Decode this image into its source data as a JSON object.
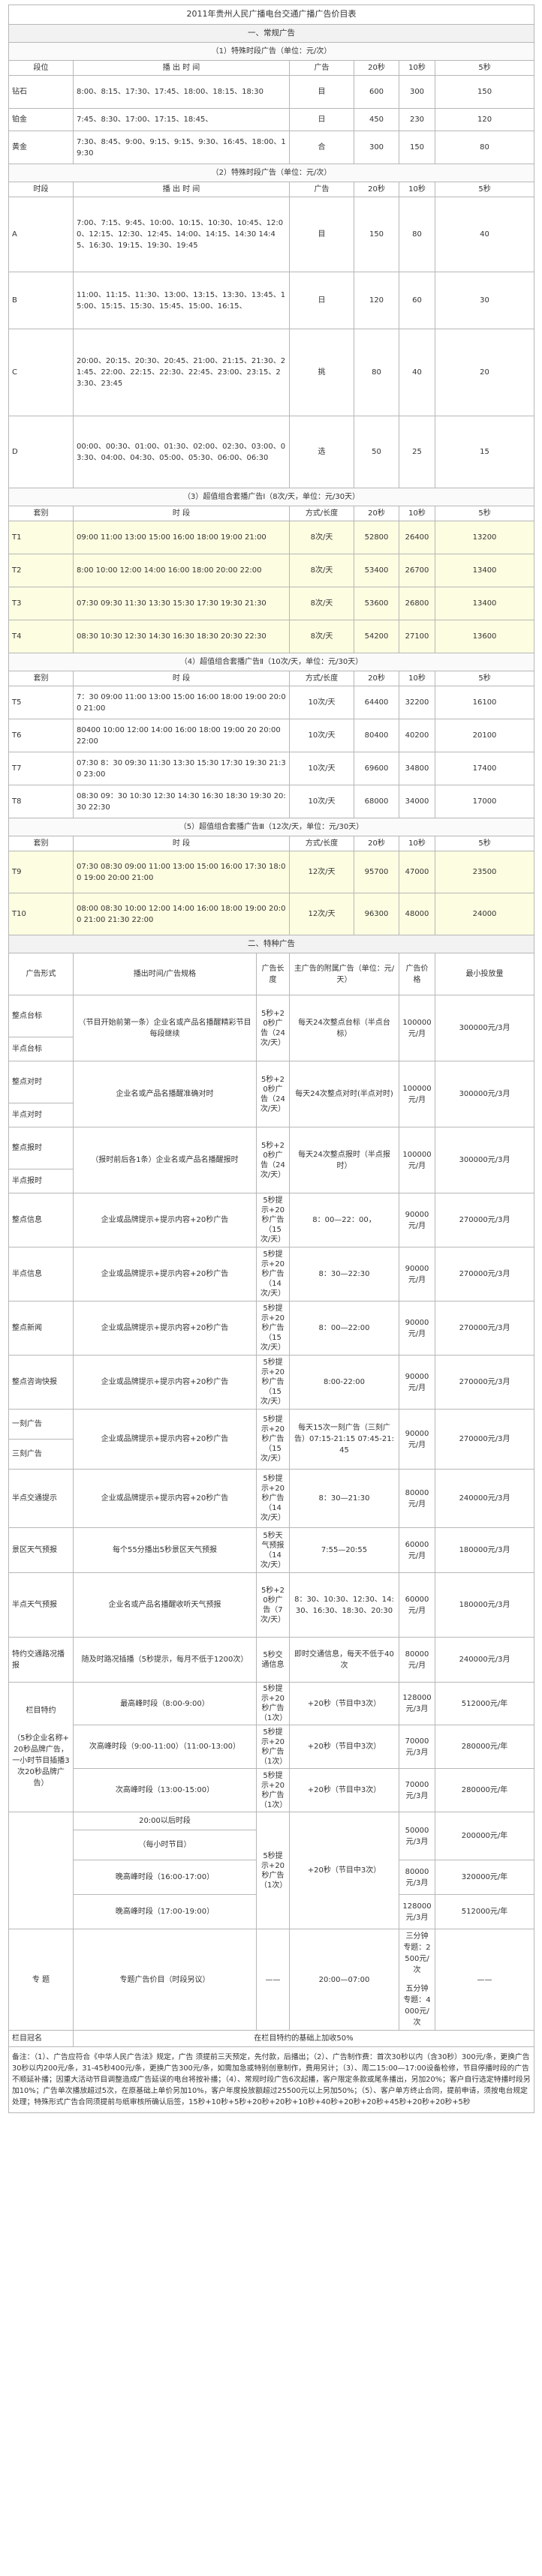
{
  "title": "2011年贵州人民广播电台交通广播广告价目表",
  "section1": {
    "label": "一、常规广告",
    "specific": {
      "label": "（1）特殊时段广告（单位：元/次）",
      "headers": [
        "段位",
        "播 出 时 间",
        "广告",
        "20秒",
        "10秒",
        "5秒"
      ],
      "rows": [
        {
          "name": "钻石",
          "time": "8:00、8:15、17:30、17:45、18:00、18:15、18:30",
          "ad": "目",
          "p20": "600",
          "p10": "300",
          "p5": "150"
        },
        {
          "name": "铂金",
          "time": "7:45、8:30、17:00、17:15、18:45、",
          "ad": "",
          "p20": "450",
          "p10": "230",
          "p5": "120"
        },
        {
          "name": "黄金",
          "time": "7:30、8:45、9:00、9:15、9:15、9:30、16:45、18:00、19:30",
          "ad": "合",
          "p20": "300",
          "p10": "150",
          "p5": "80"
        }
      ],
      "ad_top": "目",
      "ad_mid": "日",
      "ad_bot": "合"
    },
    "regular": {
      "label": "（2）特殊时段广告（单位：元/次）",
      "headers": [
        "时段",
        "播 出 时 间",
        "广告",
        "20秒",
        "10秒",
        "5秒"
      ],
      "rows": [
        {
          "name": "A",
          "time": "7:00、7:15、9:45、10:00、10:15、10:30、10:45、12:00、12:15、12:30、12:45、14:00、14:15、14:30 14:45、16:30、19:15、19:30、19:45",
          "ad": "目",
          "p20": "150",
          "p10": "80",
          "p5": "40"
        },
        {
          "name": "B",
          "time": "11:00、11:15、11:30、13:00、13:15、13:30、13:45、15:00、15:15、15:30、15:45、15:00、16:15、",
          "ad": "日",
          "p20": "120",
          "p10": "60",
          "p5": "30"
        },
        {
          "name": "C",
          "time": "20:00、20:15、20:30、20:45、21:00、21:15、21:30、21:45、22:00、22:15、22:30、22:45、23:00、23:15、23:30、23:45",
          "ad": "挑",
          "p20": "80",
          "p10": "40",
          "p5": "20"
        },
        {
          "name": "D",
          "time": "00:00、00:30、01:00、01:30、02:00、02:30、03:00、03:30、04:00、04:30、05:00、05:30、06:00、06:30",
          "ad": "选",
          "p20": "50",
          "p10": "25",
          "p5": "15"
        }
      ]
    },
    "package1": {
      "label": "（3）超值组合套播广告Ⅰ（8次/天，单位：元/30天）",
      "headers": [
        "套别",
        "时 段",
        "方式/长度",
        "20秒",
        "10秒",
        "5秒"
      ],
      "rows": [
        {
          "name": "T1",
          "time": "09:00 11:00 13:00 15:00 16:00 18:00 19:00 21:00",
          "mode": "8次/天",
          "p20": "52800",
          "p10": "26400",
          "p5": "13200"
        },
        {
          "name": "T2",
          "time": "8:00 10:00 12:00 14:00 16:00 18:00 20:00 22:00",
          "mode": "8次/天",
          "p20": "53400",
          "p10": "26700",
          "p5": "13400"
        },
        {
          "name": "T3",
          "time": "07:30 09:30 11:30 13:30 15:30 17:30 19:30 21:30",
          "mode": "8次/天",
          "p20": "53600",
          "p10": "26800",
          "p5": "13400"
        },
        {
          "name": "T4",
          "time": "08:30 10:30 12:30 14:30 16:30 18:30 20:30 22:30",
          "mode": "8次/天",
          "p20": "54200",
          "p10": "27100",
          "p5": "13600"
        }
      ]
    },
    "package2": {
      "label": "（4）超值组合套播广告Ⅱ（10次/天，单位：元/30天）",
      "headers": [
        "套别",
        "时 段",
        "方式/长度",
        "20秒",
        "10秒",
        "5秒"
      ],
      "rows": [
        {
          "name": "T5",
          "time": "7：30 09:00 11:00 13:00 15:00 16:00 18:00 19:00 20:00 21:00",
          "mode": "10次/天",
          "p20": "64400",
          "p10": "32200",
          "p5": "16100"
        },
        {
          "name": "T6",
          "time": "80400 10:00 12:00 14:00 16:00 18:00 19:00 20 20:00 22:00",
          "mode": "10次/天",
          "p20": "80400",
          "p10": "40200",
          "p5": "20100"
        },
        {
          "name": "T7",
          "time": "07:30 8：30 09:30 11:30 13:30 15:30 17:30 19:30 21:30 23:00",
          "mode": "10次/天",
          "p20": "69600",
          "p10": "34800",
          "p5": "17400"
        },
        {
          "name": "T8",
          "time": "08:30 09：30 10:30 12:30 14:30 16:30 18:30 19:30 20:30 22:30",
          "mode": "10次/天",
          "p20": "68000",
          "p10": "34000",
          "p5": "17000"
        }
      ]
    },
    "package3": {
      "label": "（5）超值组合套播广告Ⅲ（12次/天，单位：元/30天）",
      "headers": [
        "套别",
        "时 段",
        "方式/长度",
        "20秒",
        "10秒",
        "5秒"
      ],
      "rows": [
        {
          "name": "T9",
          "time": "07:30 08:30 09:00 11:00 13:00 15:00 16:00 17:30 18:00 19:00 20:00 21:00",
          "mode": "12次/天",
          "p20": "95700",
          "p10": "47000",
          "p5": "23500"
        },
        {
          "name": "T10",
          "time": "08:00 08:30 10:00 12:00 14:00 16:00 18:00 19:00 20:00 21:00 21:30 22:00",
          "mode": "12次/天",
          "p20": "96300",
          "p10": "48000",
          "p5": "24000"
        }
      ]
    }
  },
  "section2": {
    "label": "二、特种广告",
    "headers": [
      "广告形式",
      "播出时间/广告规格",
      "广告长度",
      "主广告的附属广告（单位：元/天）",
      "广告价格",
      "最小投放量"
    ],
    "rows": [
      {
        "form": "整点台标",
        "spec": "（节目开始前第一条）企业名或产品名播醒精彩节目每段继续",
        "len": "5秒+20秒广告（24次/天）",
        "sub": "每天24次整点台标（半点台标）",
        "price": "100000元/月",
        "min": "300000元/3月"
      },
      {
        "form": "半点台标",
        "spec": "",
        "len": "",
        "sub": "",
        "price": "",
        "min": ""
      },
      {
        "form": "整点对时",
        "spec": "企业名或产品名播醒准确对时",
        "len": "5秒+20秒广告（24次/天）",
        "sub": "每天24次整点对时(半点对时)",
        "price": "100000元/月",
        "min": "300000元/3月"
      },
      {
        "form": "半点对时",
        "spec": "",
        "len": "",
        "sub": "",
        "price": "",
        "min": ""
      },
      {
        "form": "整点报时",
        "spec": "（报时前后各1条）企业名或产品名播醒报时",
        "len": "5秒+20秒广告（24次/天）",
        "sub": "每天24次整点报时（半点报时）",
        "price": "100000元/月",
        "min": "300000元/3月"
      },
      {
        "form": "半点报时",
        "spec": "",
        "len": "",
        "sub": "",
        "price": "",
        "min": ""
      },
      {
        "form": "整点信息",
        "spec": "企业或品牌提示+提示内容+20秒广告",
        "len": "5秒提示+20秒广告（15次/天）",
        "sub": "8：00—22：00，",
        "price": "90000元/月",
        "min": "270000元/3月"
      },
      {
        "form": "半点信息",
        "spec": "企业或品牌提示+提示内容+20秒广告",
        "len": "5秒提示+20秒广告（14次/天）",
        "sub": "8：30—22:30",
        "price": "90000元/月",
        "min": "270000元/3月"
      },
      {
        "form": "整点新闻",
        "spec": "企业或品牌提示+提示内容+20秒广告",
        "len": "5秒提示+20秒广告（15次/天）",
        "sub": "8：00—22:00",
        "price": "90000元/月",
        "min": "270000元/3月"
      },
      {
        "form": "整点咨询快报",
        "spec": "企业或品牌提示+提示内容+20秒广告",
        "len": "5秒提示+20秒广告（15次/天）",
        "sub": "8:00-22:00",
        "price": "90000元/月",
        "min": "270000元/3月"
      },
      {
        "form": "一刻广告",
        "spec": "企业或品牌提示+提示内容+20秒广告",
        "len": "5秒提示+20秒广告（15次/天）",
        "sub": "每天15次一刻广告（三刻广告）07:15-21:15 07:45-21:45",
        "price": "90000元/月",
        "min": "270000元/3月"
      },
      {
        "form": "三刻广告",
        "spec": "",
        "len": "",
        "sub": "",
        "price": "",
        "min": ""
      },
      {
        "form": "半点交通提示",
        "spec": "企业或品牌提示+提示内容+20秒广告",
        "len": "5秒提示+20秒广告（14次/天）",
        "sub": "8：30—21:30",
        "price": "80000元/月",
        "min": "240000元/3月"
      },
      {
        "form": "景区天气预报",
        "spec": "每个55分播出5秒景区天气预报",
        "len": "5秒天气预报（14次/天）",
        "sub": "7:55—20:55",
        "price": "60000元/月",
        "min": "180000元/3月"
      },
      {
        "form": "半点天气预报",
        "spec": "企业名或产品名播醒收听天气预报",
        "len": "5秒+20秒广告（7次/天）",
        "sub": "8：30、10:30、12:30、14:30、16:30、18:30、20:30",
        "price": "60000元/月",
        "min": "180000元/3月"
      },
      {
        "form": "特约交通路况播报",
        "spec": "随及时路况插播（5秒提示，每月不低于1200次）",
        "len": "5秒交通信息",
        "sub": "即时交通信息，每天不低于40次",
        "price": "80000元/月",
        "min": "240000元/3月"
      }
    ],
    "sponsor": {
      "form_title": "栏目特约",
      "form_desc": "（5秒企业名称+20秒品牌广告，一小时节目插播3次20秒品牌广告）",
      "rows": [
        {
          "spec": "最高峰时段（8:00-9:00）",
          "len": "5秒提示+20秒广告（1次）",
          "sub": "+20秒（节目中3次）",
          "price": "128000元/3月",
          "min": "512000元/年"
        },
        {
          "spec": "次高峰时段（9:00-11:00）（11:00-13:00）",
          "len": "5秒提示+20秒广告（1次）",
          "sub": "+20秒（节目中3次）",
          "price": "70000元/3月",
          "min": "280000元/年"
        },
        {
          "spec": "次高峰时段（13:00-15:00）",
          "len": "5秒提示+20秒广告（1次）",
          "sub": "+20秒（节目中3次）",
          "price": "70000元/3月",
          "min": "280000元/年"
        }
      ],
      "midnight_label": "20:00以后时段",
      "hourly_label": "（每小时节目）",
      "hourly_rows": [
        {
          "spec": "晚高峰时段（16:00-17:00）",
          "price": "80000元/3月",
          "min": "320000元/年"
        },
        {
          "spec": "晚高峰时段（17:00-19:00）",
          "price": "128000元/3月",
          "min": "512000元/年"
        }
      ],
      "first_price": "50000元/3月",
      "first_min": "200000元/年",
      "hourly_len": "5秒提示+20秒广告（1次）",
      "hourly_sub": "+20秒（节目中3次）"
    },
    "special": {
      "form": "专 题",
      "spec": "专题广告价目（时段另议）",
      "len": "——",
      "sub": "20:00—07:00",
      "price_lines": [
        "三分钟 专题：2500元/次",
        "五分钟 专题：4000元/次"
      ],
      "min": "——"
    },
    "naming": {
      "form": "栏目冠名",
      "desc": "在栏目特约的基础上加收50%"
    }
  },
  "note": "备注：（1）、广告应符合《中华人民广告法》规定，广告 须提前三天预定，先付款，后播出；（2）、广告制作费：首次30秒以内（含30秒）300元/条，更换广告30秒以内200元/条，31-45秒400元/条，更换广告300元/条，如需加急或特别创意制作，费用另计；（3）、周二15:00—17:00设备检修，节目停播时段的广告不顺延补播；因重大活动节目调整造成广告延误的电台将按补播；（4）、常规时段广告6次起播，客户限定条款或尾条播出，另加20%；客户自行选定特播时段另加10%；广告单次播放超过5次，在原基础上单价另加10%，客户年度投放额超过25500元以上另加50%；（5）、客户单方终止合同，提前申请，须按电台规定处理；特殊形式广告合同须提前与纸审核所确认后签，15秒+10秒+5秒+20秒+20秒+10秒+40秒+20秒+20秒+45秒+20秒+20秒+5秒"
}
